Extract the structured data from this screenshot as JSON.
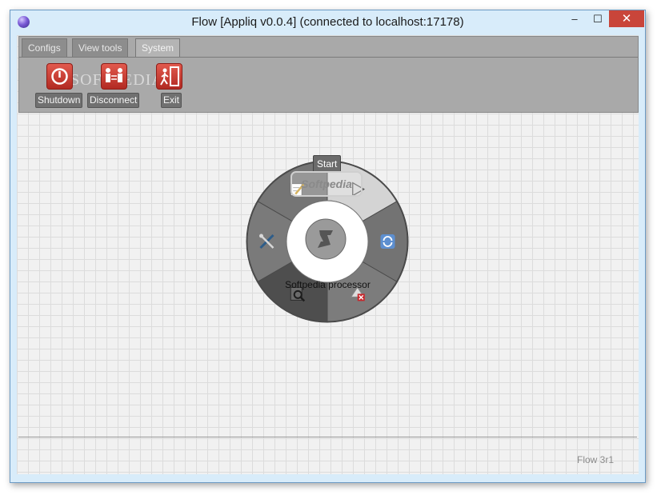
{
  "window": {
    "title": "Flow [Appliq v0.0.4] (connected to localhost:17178)",
    "controls": {
      "minimize": "–",
      "maximize": "☐",
      "close": "✕"
    }
  },
  "ribbon": {
    "tabs": [
      {
        "label": "Configs",
        "active": false
      },
      {
        "label": "View tools",
        "active": false
      },
      {
        "label": "System",
        "active": true
      }
    ],
    "tools": [
      {
        "label": "Shutdown",
        "icon": "power-icon"
      },
      {
        "label": "Disconnect",
        "icon": "disconnect-icon"
      },
      {
        "label": "Exit",
        "icon": "exit-icon"
      }
    ],
    "watermark": "SOFTPEDIA"
  },
  "wheel": {
    "start_label": "Start",
    "watermark": "Softpedia",
    "center_label": "Softpedia processor",
    "center_icon": "script-icon",
    "segments": [
      {
        "name": "edit",
        "icon": "edit-icon"
      },
      {
        "name": "start",
        "icon": "play-icon"
      },
      {
        "name": "refresh",
        "icon": "refresh-icon"
      },
      {
        "name": "remove",
        "icon": "remove-icon"
      },
      {
        "name": "inspect",
        "icon": "inspect-icon"
      },
      {
        "name": "settings",
        "icon": "tools-icon"
      }
    ]
  },
  "status": {
    "version": "Flow 3r1"
  },
  "colors": {
    "close_button": "#c9453a",
    "tool_icon": "#d2433a",
    "titlebar": "#d8ecfa"
  }
}
